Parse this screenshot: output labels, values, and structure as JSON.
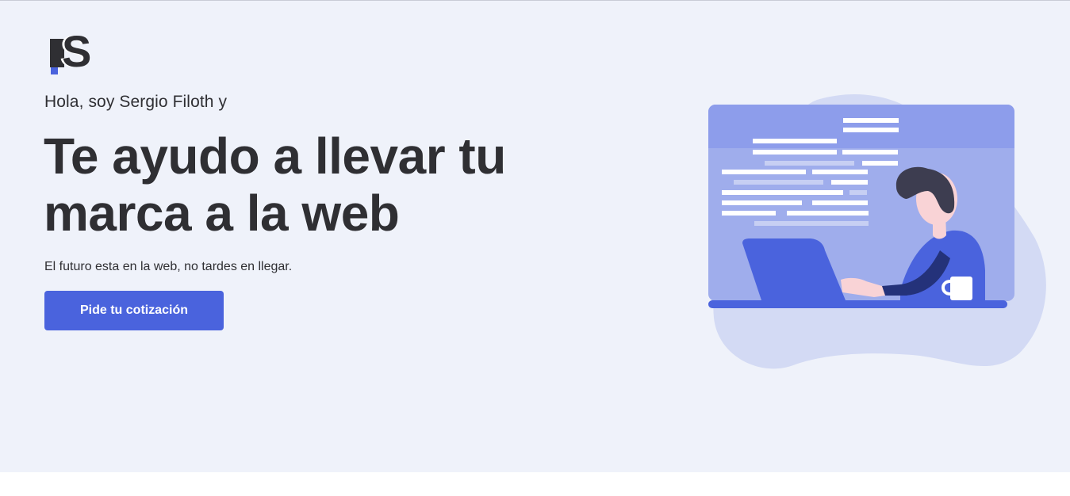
{
  "logo": {
    "letter": "S"
  },
  "hero": {
    "greeting": "Hola, soy Sergio Filoth y",
    "headline": "Te ayudo a llevar tu marca a la web",
    "tagline": "El futuro esta en la web, no tardes en llegar.",
    "cta_label": "Pide tu cotización"
  },
  "illustration": {
    "icon": "developer-at-laptop-illustration"
  },
  "colors": {
    "accent": "#4a63dd",
    "background": "#eff2fa",
    "text": "#2f2f33",
    "panel": "#9fadec",
    "blob": "#d3daf4"
  }
}
